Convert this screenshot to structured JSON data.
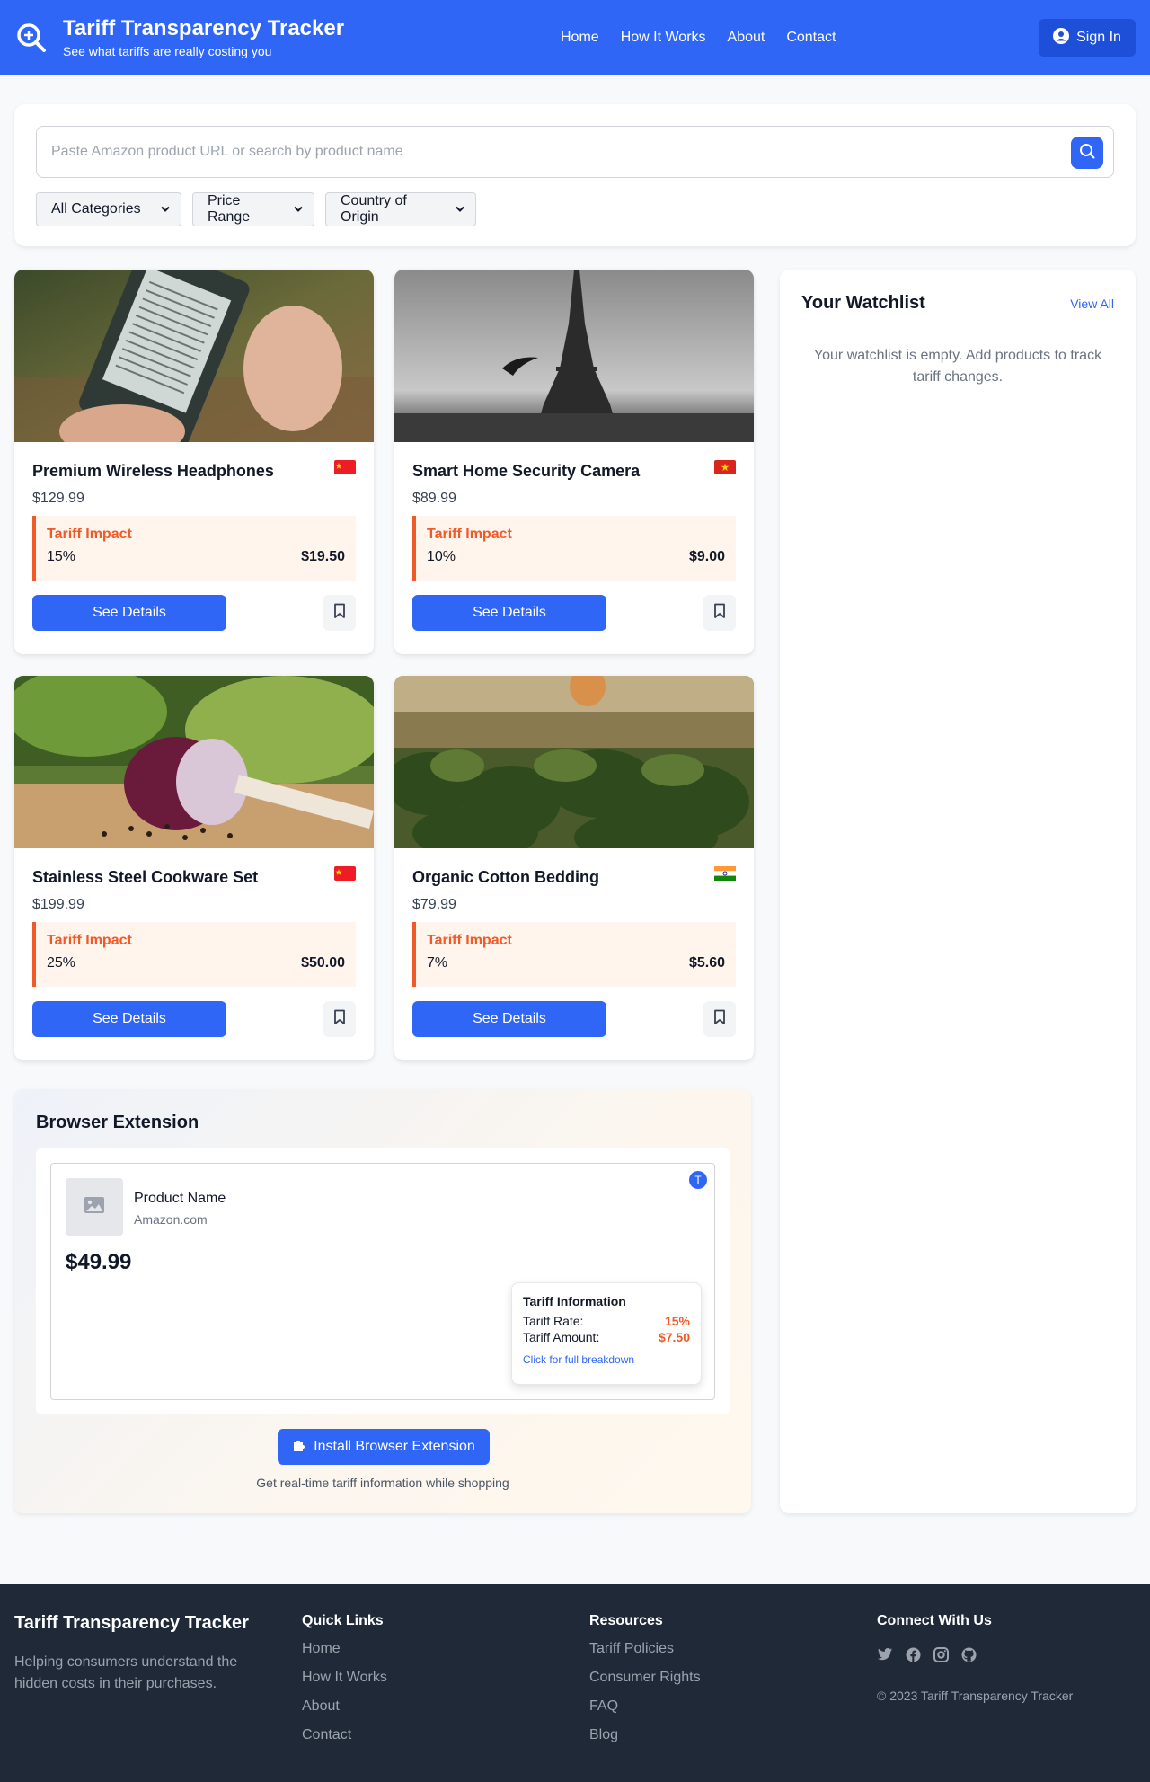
{
  "header": {
    "title": "Tariff Transparency Tracker",
    "tagline": "See what tariffs are really costing you",
    "nav": [
      "Home",
      "How It Works",
      "About",
      "Contact"
    ],
    "signin": "Sign In"
  },
  "search": {
    "placeholder": "Paste Amazon product URL or search by product name",
    "filters": [
      "All Categories",
      "Price Range",
      "Country of Origin"
    ]
  },
  "products": [
    {
      "name": "Premium Wireless Headphones",
      "price": "$129.99",
      "origin": "China",
      "tariff_label": "Tariff Impact",
      "rate": "15%",
      "amount": "$19.50",
      "details": "See Details"
    },
    {
      "name": "Smart Home Security Camera",
      "price": "$89.99",
      "origin": "Vietnam",
      "tariff_label": "Tariff Impact",
      "rate": "10%",
      "amount": "$9.00",
      "details": "See Details"
    },
    {
      "name": "Stainless Steel Cookware Set",
      "price": "$199.99",
      "origin": "China",
      "tariff_label": "Tariff Impact",
      "rate": "25%",
      "amount": "$50.00",
      "details": "See Details"
    },
    {
      "name": "Organic Cotton Bedding",
      "price": "$79.99",
      "origin": "India",
      "tariff_label": "Tariff Impact",
      "rate": "7%",
      "amount": "$5.60",
      "details": "See Details"
    }
  ],
  "watchlist": {
    "title": "Your Watchlist",
    "view_all": "View All",
    "empty": "Your watchlist is empty. Add products to track tariff changes."
  },
  "extension": {
    "title": "Browser Extension",
    "product_name": "Product Name",
    "store": "Amazon.com",
    "price": "$49.99",
    "badge": "T",
    "tooltip_title": "Tariff Information",
    "rate_label": "Tariff Rate:",
    "rate": "15%",
    "amount_label": "Tariff Amount:",
    "amount": "$7.50",
    "link": "Click for full breakdown",
    "install": "Install Browser Extension",
    "note": "Get real-time tariff information while shopping"
  },
  "footer": {
    "brand": "Tariff Transparency Tracker",
    "desc": "Helping consumers understand the hidden costs in their purchases.",
    "quick_title": "Quick Links",
    "quick": [
      "Home",
      "How It Works",
      "About",
      "Contact"
    ],
    "resources_title": "Resources",
    "resources": [
      "Tariff Policies",
      "Consumer Rights",
      "FAQ",
      "Blog"
    ],
    "connect_title": "Connect With Us",
    "socials": [
      "twitter-icon",
      "facebook-icon",
      "instagram-icon",
      "github-icon"
    ],
    "copyright": "© 2023 Tariff Transparency Tracker"
  },
  "colors": {
    "primary": "#2f66f5",
    "tariff": "#f05a28",
    "footer": "#1f2937"
  }
}
